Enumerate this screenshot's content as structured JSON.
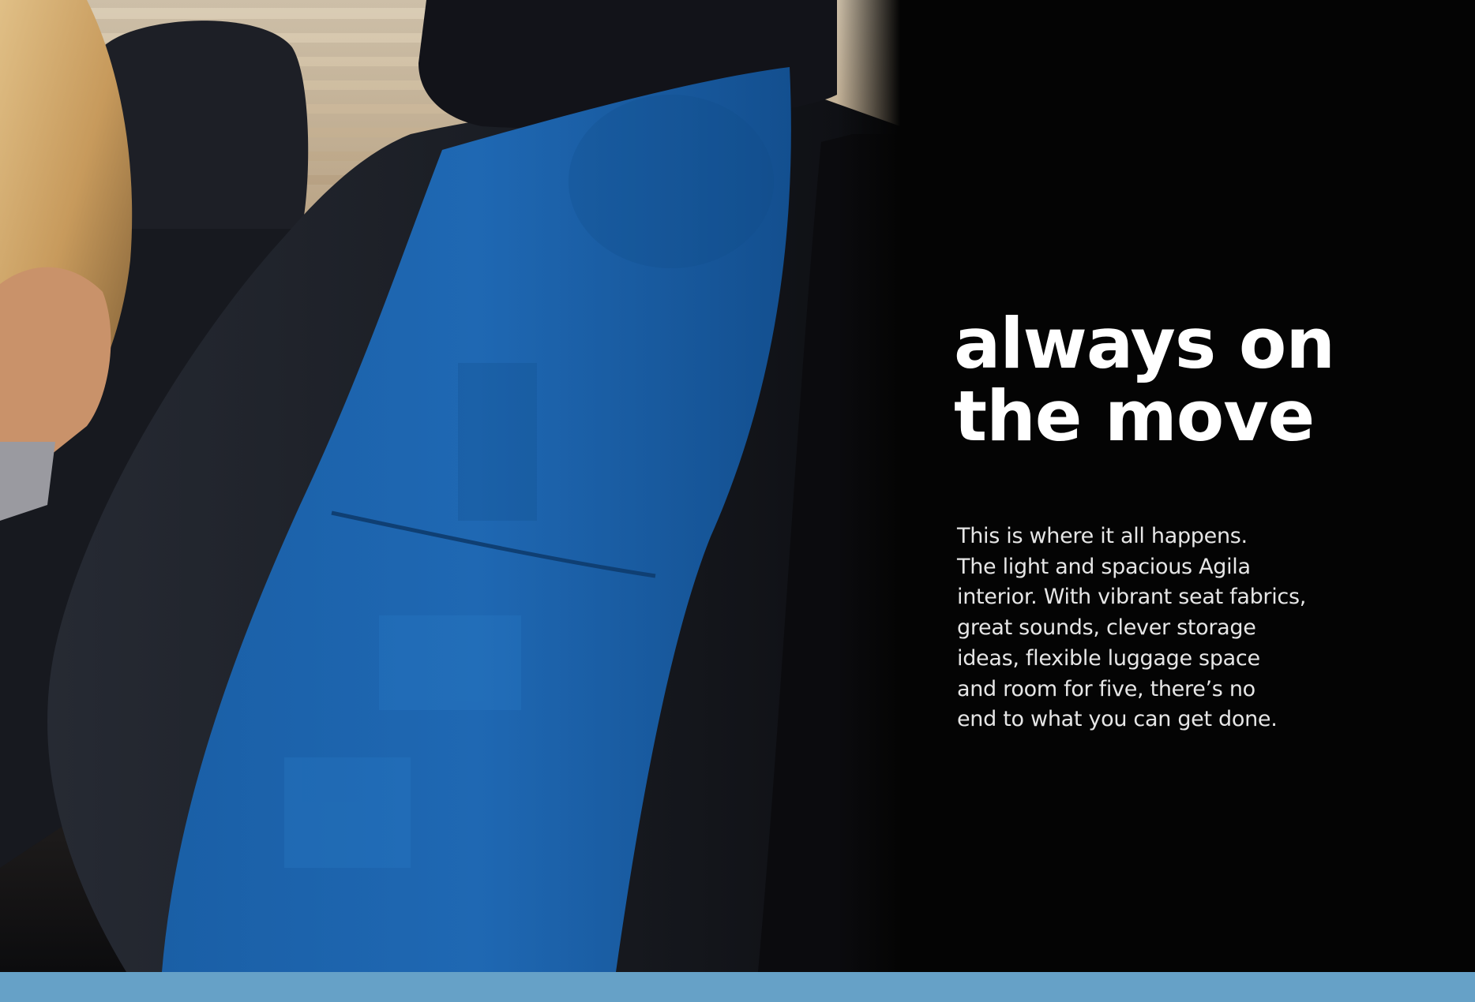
{
  "headline": {
    "lines": [
      "always on",
      "the move"
    ]
  },
  "body": {
    "lines": [
      "This is where it all happens.",
      "The light and spacious Agila",
      "interior. With vibrant seat fabrics,",
      "great sounds, clever storage",
      "ideas, flexible luggage space",
      "and room for five, there’s no",
      "end to what you can get done."
    ]
  },
  "colors": {
    "background": "#040404",
    "seat_blue": "#1c64ad",
    "seat_black": "#15171d",
    "footer_band": "#66a1c7",
    "headline_text": "#ffffff"
  }
}
